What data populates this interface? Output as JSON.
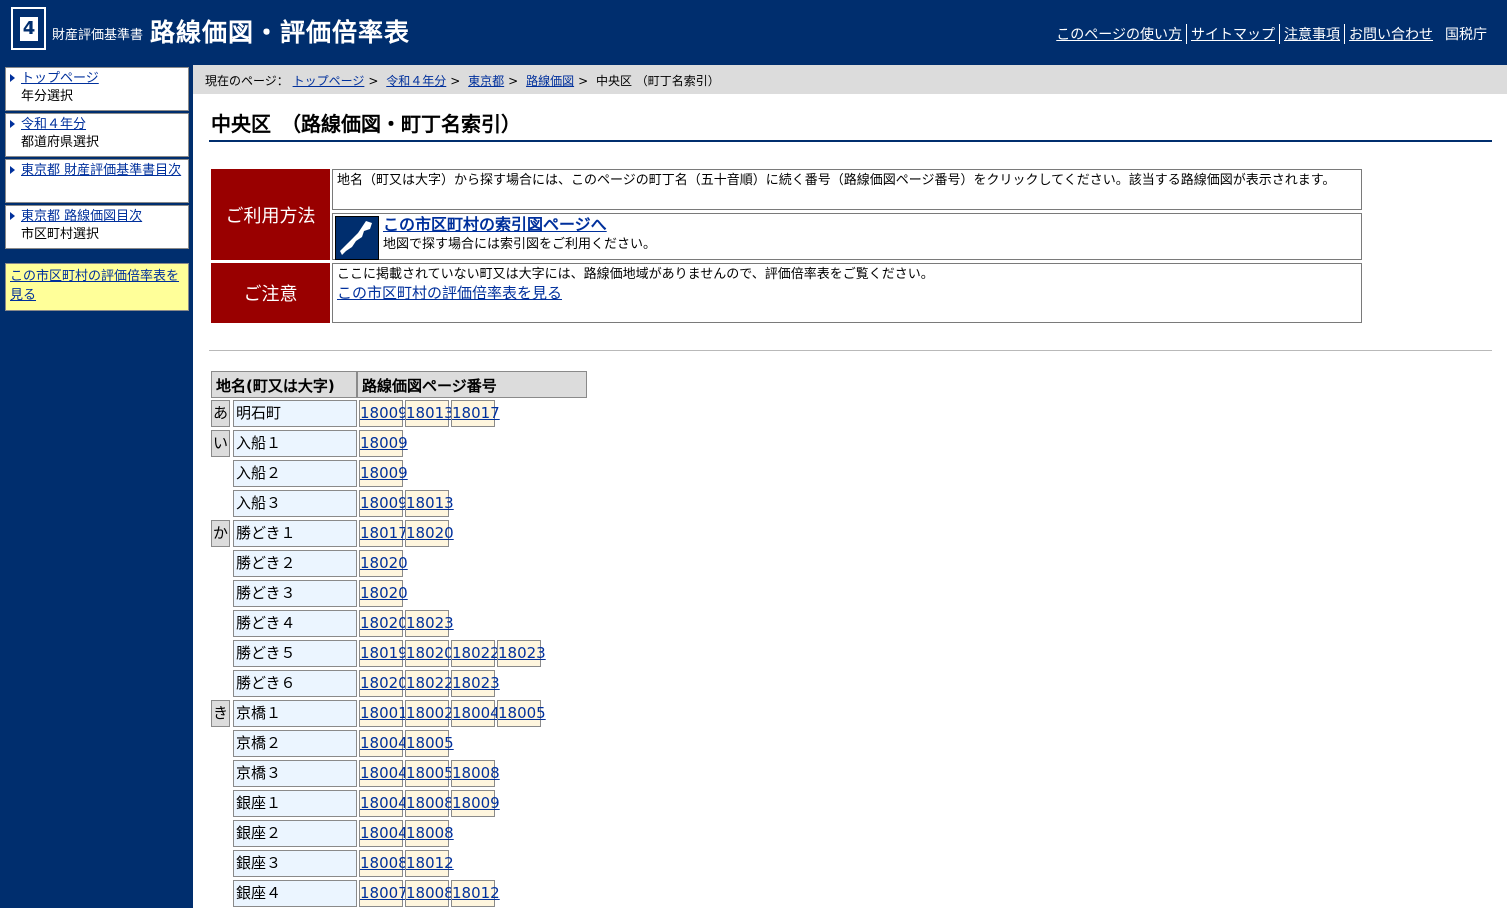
{
  "header": {
    "logo_number": "4",
    "sub_title": "財産評価基準書",
    "title": "路線価図・評価倍率表",
    "nav": [
      "このページの使い方",
      "サイトマップ",
      "注意事項",
      "お問い合わせ"
    ],
    "agency": "国税庁"
  },
  "sidebar": {
    "items": [
      {
        "link": "トップページ",
        "sub": "年分選択"
      },
      {
        "link": "令和４年分",
        "sub": "都道府県選択"
      },
      {
        "link": "東京都 財産評価基準書目次",
        "sub": ""
      },
      {
        "link": "東京都 路線価図目次",
        "sub": "市区町村選択"
      }
    ],
    "highlight": "この市区町村の評価倍率表を見る"
  },
  "breadcrumb": {
    "prefix": "現在のページ：",
    "links": [
      "トップページ",
      "令和４年分",
      "東京都",
      "路線価図"
    ],
    "current": "中央区 （町丁名索引）"
  },
  "page_title": "中央区　（路線価図・町丁名索引）",
  "info": {
    "usage_label": "ご利用方法",
    "usage_text": "地名（町又は大字）から探す場合には、このページの町丁名（五十音順）に続く番号（路線価図ページ番号）をクリックしてください。該当する路線価図が表示されます。",
    "index_link": "この市区町村の索引図ページへ",
    "index_text": "地図で探す場合には索引図をご利用ください。",
    "caution_label": "ご注意",
    "caution_text": "ここに掲載されていない町又は大字には、路線価地域がありませんので、評価倍率表をご覧ください。",
    "caution_link": "この市区町村の評価倍率表を見る"
  },
  "table": {
    "headers": [
      "地名(町又は大字)",
      "路線価図ページ番号"
    ],
    "rows": [
      {
        "kana": "あ",
        "name": "明石町",
        "pages": [
          "18009",
          "18013",
          "18017"
        ]
      },
      {
        "kana": "い",
        "name": "入船１",
        "pages": [
          "18009"
        ]
      },
      {
        "kana": "",
        "name": "入船２",
        "pages": [
          "18009"
        ]
      },
      {
        "kana": "",
        "name": "入船３",
        "pages": [
          "18009",
          "18013"
        ]
      },
      {
        "kana": "か",
        "name": "勝どき１",
        "pages": [
          "18017",
          "18020"
        ]
      },
      {
        "kana": "",
        "name": "勝どき２",
        "pages": [
          "18020"
        ]
      },
      {
        "kana": "",
        "name": "勝どき３",
        "pages": [
          "18020"
        ]
      },
      {
        "kana": "",
        "name": "勝どき４",
        "pages": [
          "18020",
          "18023"
        ]
      },
      {
        "kana": "",
        "name": "勝どき５",
        "pages": [
          "18019",
          "18020",
          "18022",
          "18023"
        ]
      },
      {
        "kana": "",
        "name": "勝どき６",
        "pages": [
          "18020",
          "18022",
          "18023"
        ]
      },
      {
        "kana": "き",
        "name": "京橋１",
        "pages": [
          "18001",
          "18002",
          "18004",
          "18005"
        ]
      },
      {
        "kana": "",
        "name": "京橋２",
        "pages": [
          "18004",
          "18005"
        ]
      },
      {
        "kana": "",
        "name": "京橋３",
        "pages": [
          "18004",
          "18005",
          "18008"
        ]
      },
      {
        "kana": "",
        "name": "銀座１",
        "pages": [
          "18004",
          "18008",
          "18009"
        ]
      },
      {
        "kana": "",
        "name": "銀座２",
        "pages": [
          "18004",
          "18008"
        ]
      },
      {
        "kana": "",
        "name": "銀座３",
        "pages": [
          "18008",
          "18012"
        ]
      },
      {
        "kana": "",
        "name": "銀座４",
        "pages": [
          "18007",
          "18008",
          "18012"
        ]
      }
    ]
  }
}
